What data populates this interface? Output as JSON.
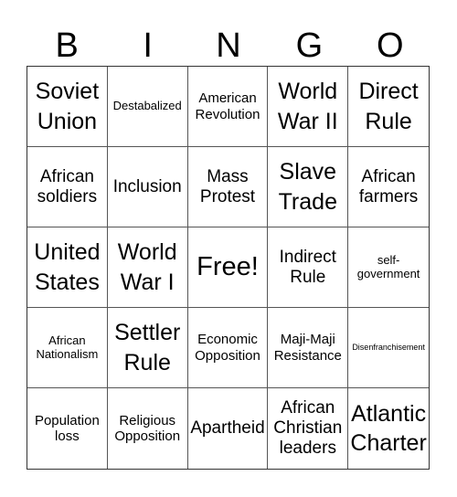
{
  "header": [
    "B",
    "I",
    "N",
    "G",
    "O"
  ],
  "cells": [
    {
      "text": "Soviet Union",
      "size": "s-xl"
    },
    {
      "text": "Destabalized",
      "size": "s-s"
    },
    {
      "text": "American Revolution",
      "size": "s-m"
    },
    {
      "text": "World War II",
      "size": "s-xl"
    },
    {
      "text": "Direct Rule",
      "size": "s-xl"
    },
    {
      "text": "African soldiers",
      "size": "s-l"
    },
    {
      "text": "Inclusion",
      "size": "s-l"
    },
    {
      "text": "Mass Protest",
      "size": "s-l"
    },
    {
      "text": "Slave Trade",
      "size": "s-xl"
    },
    {
      "text": "African farmers",
      "size": "s-l"
    },
    {
      "text": "United States",
      "size": "s-xl"
    },
    {
      "text": "World War I",
      "size": "s-xl"
    },
    {
      "text": "Free!",
      "size": "s-xxl"
    },
    {
      "text": "Indirect Rule",
      "size": "s-l"
    },
    {
      "text": "self-government",
      "size": "s-s"
    },
    {
      "text": "African Nationalism",
      "size": "s-s"
    },
    {
      "text": "Settler Rule",
      "size": "s-xl"
    },
    {
      "text": "Economic Opposition",
      "size": "s-m"
    },
    {
      "text": "Maji-Maji Resistance",
      "size": "s-m"
    },
    {
      "text": "Disenfranchisement",
      "size": "s-xs"
    },
    {
      "text": "Population loss",
      "size": "s-m"
    },
    {
      "text": "Religious Opposition",
      "size": "s-m"
    },
    {
      "text": "Apartheid",
      "size": "s-l"
    },
    {
      "text": "African Christian leaders",
      "size": "s-l"
    },
    {
      "text": "Atlantic Charter",
      "size": "s-xl"
    }
  ]
}
